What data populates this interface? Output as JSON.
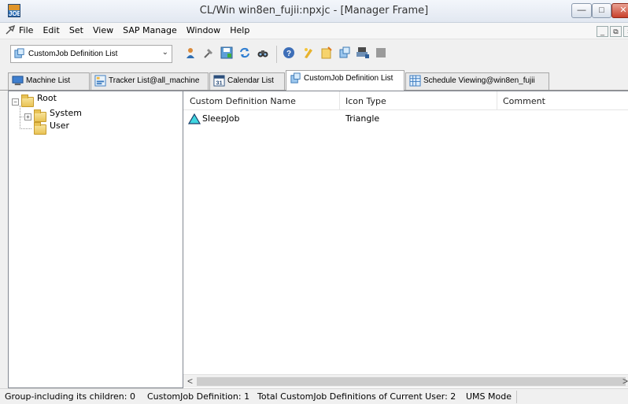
{
  "window": {
    "title": "CL/Win win8en_fujii:npxjc - [Manager Frame]",
    "app_icon_text": "JOB",
    "minimize_glyph": "—",
    "maximize_glyph": "□",
    "close_glyph": "✕"
  },
  "menubar": {
    "items": [
      "File",
      "Edit",
      "Set",
      "View",
      "SAP Manage",
      "Window",
      "Help"
    ],
    "mdi_min_glyph": "_",
    "mdi_restore_glyph": "⧉",
    "mdi_close_glyph": "×"
  },
  "toolbar": {
    "combo_value": "CustomJob Definition List",
    "combo_arrow": "⌄",
    "icons": [
      "user-icon",
      "properties-icon",
      "save-icon",
      "refresh-icon",
      "find-icon",
      "help-icon",
      "new-job-icon",
      "edit-job-icon",
      "customjob-icon",
      "print-icon",
      "stop-icon"
    ]
  },
  "tabs": [
    {
      "label": "Machine List"
    },
    {
      "label": "Tracker List@all_machine"
    },
    {
      "label": "Calendar List",
      "icon_text": "31"
    },
    {
      "label": "CustomJob Definition List"
    },
    {
      "label": "Schedule Viewing@win8en_fujii"
    }
  ],
  "tree": {
    "root": "Root",
    "children": [
      "System",
      "User"
    ],
    "collapse_glyph": "−",
    "expand_glyph": "+"
  },
  "list": {
    "columns": [
      "Custom Definition Name",
      "Icon Type",
      "Comment"
    ],
    "sort_caret": "^",
    "rows": [
      {
        "name": "SleepJob",
        "icon_type": "Triangle",
        "comment": ""
      }
    ],
    "scroll_left": "<",
    "scroll_right": ">"
  },
  "status": {
    "group_children": "Group-including its children: 0",
    "customjob_def": "CustomJob Definition: 1",
    "total": "Total CustomJob Definitions of Current User: 2",
    "mode": "UMS Mode"
  }
}
